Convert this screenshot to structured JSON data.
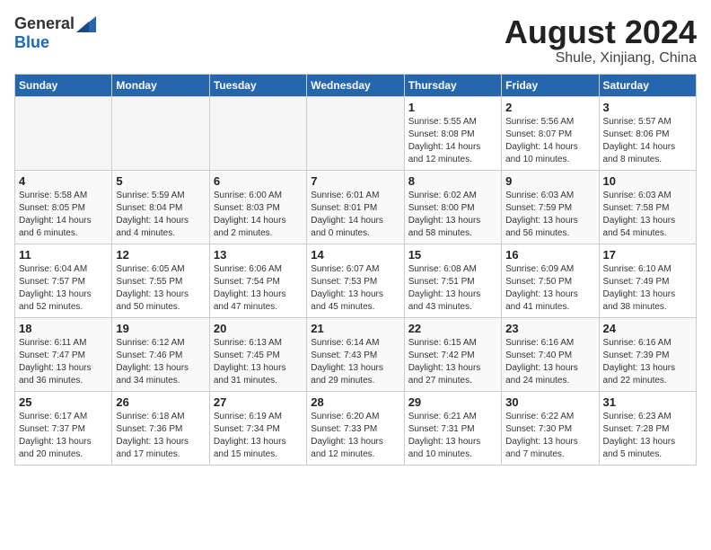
{
  "header": {
    "logo_general": "General",
    "logo_blue": "Blue",
    "month_title": "August 2024",
    "location": "Shule, Xinjiang, China"
  },
  "weekdays": [
    "Sunday",
    "Monday",
    "Tuesday",
    "Wednesday",
    "Thursday",
    "Friday",
    "Saturday"
  ],
  "weeks": [
    [
      {
        "day": "",
        "info": ""
      },
      {
        "day": "",
        "info": ""
      },
      {
        "day": "",
        "info": ""
      },
      {
        "day": "",
        "info": ""
      },
      {
        "day": "1",
        "info": "Sunrise: 5:55 AM\nSunset: 8:08 PM\nDaylight: 14 hours\nand 12 minutes."
      },
      {
        "day": "2",
        "info": "Sunrise: 5:56 AM\nSunset: 8:07 PM\nDaylight: 14 hours\nand 10 minutes."
      },
      {
        "day": "3",
        "info": "Sunrise: 5:57 AM\nSunset: 8:06 PM\nDaylight: 14 hours\nand 8 minutes."
      }
    ],
    [
      {
        "day": "4",
        "info": "Sunrise: 5:58 AM\nSunset: 8:05 PM\nDaylight: 14 hours\nand 6 minutes."
      },
      {
        "day": "5",
        "info": "Sunrise: 5:59 AM\nSunset: 8:04 PM\nDaylight: 14 hours\nand 4 minutes."
      },
      {
        "day": "6",
        "info": "Sunrise: 6:00 AM\nSunset: 8:03 PM\nDaylight: 14 hours\nand 2 minutes."
      },
      {
        "day": "7",
        "info": "Sunrise: 6:01 AM\nSunset: 8:01 PM\nDaylight: 14 hours\nand 0 minutes."
      },
      {
        "day": "8",
        "info": "Sunrise: 6:02 AM\nSunset: 8:00 PM\nDaylight: 13 hours\nand 58 minutes."
      },
      {
        "day": "9",
        "info": "Sunrise: 6:03 AM\nSunset: 7:59 PM\nDaylight: 13 hours\nand 56 minutes."
      },
      {
        "day": "10",
        "info": "Sunrise: 6:03 AM\nSunset: 7:58 PM\nDaylight: 13 hours\nand 54 minutes."
      }
    ],
    [
      {
        "day": "11",
        "info": "Sunrise: 6:04 AM\nSunset: 7:57 PM\nDaylight: 13 hours\nand 52 minutes."
      },
      {
        "day": "12",
        "info": "Sunrise: 6:05 AM\nSunset: 7:55 PM\nDaylight: 13 hours\nand 50 minutes."
      },
      {
        "day": "13",
        "info": "Sunrise: 6:06 AM\nSunset: 7:54 PM\nDaylight: 13 hours\nand 47 minutes."
      },
      {
        "day": "14",
        "info": "Sunrise: 6:07 AM\nSunset: 7:53 PM\nDaylight: 13 hours\nand 45 minutes."
      },
      {
        "day": "15",
        "info": "Sunrise: 6:08 AM\nSunset: 7:51 PM\nDaylight: 13 hours\nand 43 minutes."
      },
      {
        "day": "16",
        "info": "Sunrise: 6:09 AM\nSunset: 7:50 PM\nDaylight: 13 hours\nand 41 minutes."
      },
      {
        "day": "17",
        "info": "Sunrise: 6:10 AM\nSunset: 7:49 PM\nDaylight: 13 hours\nand 38 minutes."
      }
    ],
    [
      {
        "day": "18",
        "info": "Sunrise: 6:11 AM\nSunset: 7:47 PM\nDaylight: 13 hours\nand 36 minutes."
      },
      {
        "day": "19",
        "info": "Sunrise: 6:12 AM\nSunset: 7:46 PM\nDaylight: 13 hours\nand 34 minutes."
      },
      {
        "day": "20",
        "info": "Sunrise: 6:13 AM\nSunset: 7:45 PM\nDaylight: 13 hours\nand 31 minutes."
      },
      {
        "day": "21",
        "info": "Sunrise: 6:14 AM\nSunset: 7:43 PM\nDaylight: 13 hours\nand 29 minutes."
      },
      {
        "day": "22",
        "info": "Sunrise: 6:15 AM\nSunset: 7:42 PM\nDaylight: 13 hours\nand 27 minutes."
      },
      {
        "day": "23",
        "info": "Sunrise: 6:16 AM\nSunset: 7:40 PM\nDaylight: 13 hours\nand 24 minutes."
      },
      {
        "day": "24",
        "info": "Sunrise: 6:16 AM\nSunset: 7:39 PM\nDaylight: 13 hours\nand 22 minutes."
      }
    ],
    [
      {
        "day": "25",
        "info": "Sunrise: 6:17 AM\nSunset: 7:37 PM\nDaylight: 13 hours\nand 20 minutes."
      },
      {
        "day": "26",
        "info": "Sunrise: 6:18 AM\nSunset: 7:36 PM\nDaylight: 13 hours\nand 17 minutes."
      },
      {
        "day": "27",
        "info": "Sunrise: 6:19 AM\nSunset: 7:34 PM\nDaylight: 13 hours\nand 15 minutes."
      },
      {
        "day": "28",
        "info": "Sunrise: 6:20 AM\nSunset: 7:33 PM\nDaylight: 13 hours\nand 12 minutes."
      },
      {
        "day": "29",
        "info": "Sunrise: 6:21 AM\nSunset: 7:31 PM\nDaylight: 13 hours\nand 10 minutes."
      },
      {
        "day": "30",
        "info": "Sunrise: 6:22 AM\nSunset: 7:30 PM\nDaylight: 13 hours\nand 7 minutes."
      },
      {
        "day": "31",
        "info": "Sunrise: 6:23 AM\nSunset: 7:28 PM\nDaylight: 13 hours\nand 5 minutes."
      }
    ]
  ]
}
